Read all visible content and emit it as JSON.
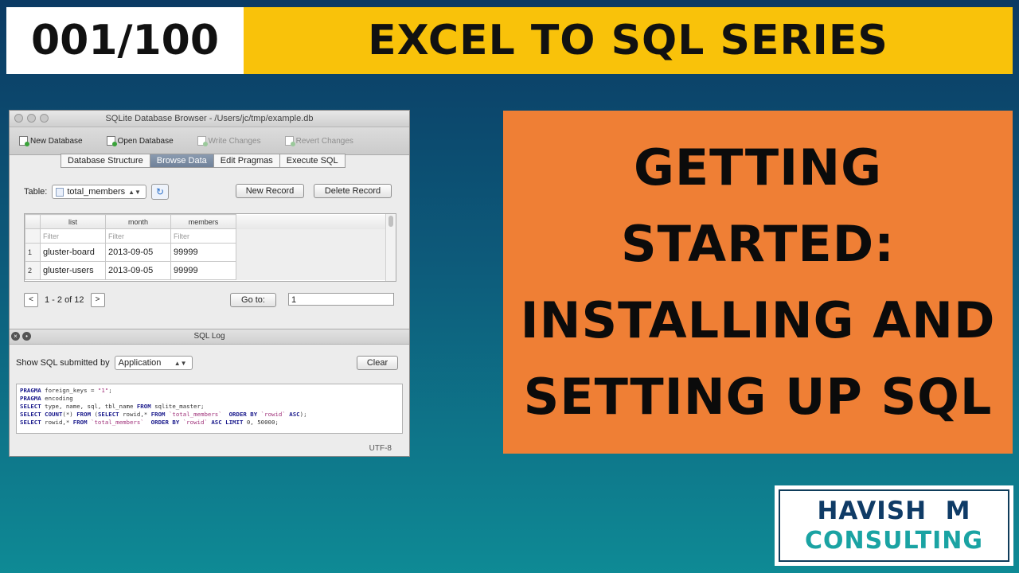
{
  "banner": {
    "counter": "001/100",
    "series": "EXCEL TO SQL SERIES"
  },
  "title_lines": [
    "GETTING",
    "STARTED:",
    "INSTALLING AND",
    "SETTING UP SQL"
  ],
  "brand": {
    "line1": "HAVISH  M",
    "line2": "CONSULTING"
  },
  "window": {
    "title": "SQLite Database Browser - /Users/jc/tmp/example.db",
    "toolbar": [
      "New Database",
      "Open Database",
      "Write Changes",
      "Revert Changes"
    ],
    "tabs": [
      "Database Structure",
      "Browse Data",
      "Edit Pragmas",
      "Execute SQL"
    ],
    "active_tab": "Browse Data",
    "table_label": "Table:",
    "table_value": "total_members",
    "new_record": "New Record",
    "delete_record": "Delete Record",
    "columns": [
      "list",
      "month",
      "members"
    ],
    "filter_placeholder": "Filter",
    "rows": [
      {
        "num": "1",
        "list": "gluster-board",
        "month": "2013-09-05",
        "members": "99999"
      },
      {
        "num": "2",
        "list": "gluster-users",
        "month": "2013-09-05",
        "members": "99999"
      }
    ],
    "pager": {
      "prev": "<",
      "range": "1 - 2 of 12",
      "next": ">",
      "goto_label": "Go to:",
      "goto_value": "1"
    },
    "log": {
      "title": "SQL Log",
      "show_label": "Show SQL submitted by",
      "source": "Application",
      "clear": "Clear",
      "encoding": "UTF-8"
    }
  },
  "colors": {
    "banner_yellow": "#f9c20a",
    "title_orange": "#ef7f35",
    "brand_navy": "#0f3b66",
    "brand_teal": "#1aa3a3"
  }
}
